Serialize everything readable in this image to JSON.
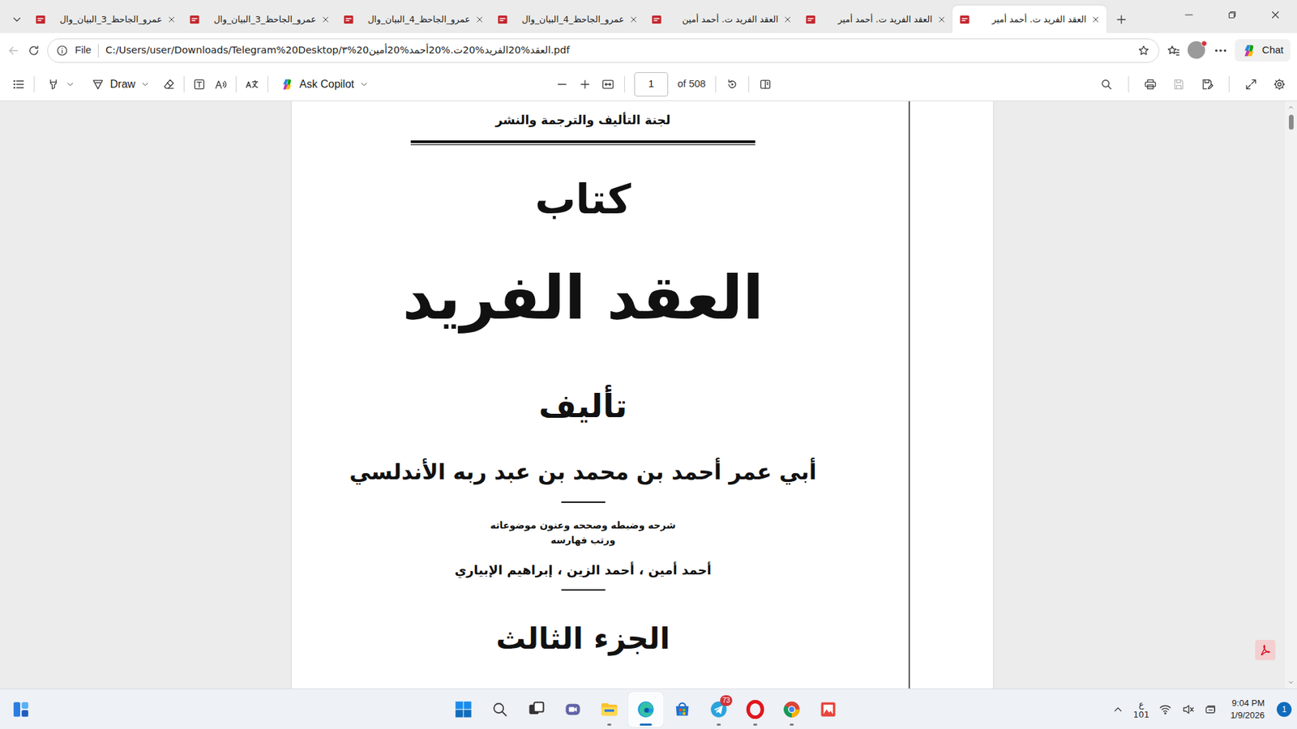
{
  "tabs": [
    {
      "label": "عمرو_الجاحظ_3_البيان_وال",
      "selected": false
    },
    {
      "label": "عمرو_الجاحظ_3_البيان_وال",
      "selected": false
    },
    {
      "label": "عمرو_الجاحظ_4_البيان_وال",
      "selected": false
    },
    {
      "label": "عمرو_الجاحظ_4_البيان_وال",
      "selected": false
    },
    {
      "label": "العقد الفريد ت. أحمد أمين",
      "selected": false
    },
    {
      "label": "العقد الفريد ت. أحمد أمير",
      "selected": false
    },
    {
      "label": "العقد الفريد ت. أحمد أمير",
      "selected": true
    }
  ],
  "address_bar": {
    "scheme": "File",
    "url": "C:/Users/user/Downloads/Telegram%20Desktop/٣%20العقد%20الفريد%20ت.%20أحمد%20أمين.pdf"
  },
  "profile": {
    "alert": true
  },
  "chat_button": {
    "label": "Chat"
  },
  "pdf_toolbar": {
    "draw_label": "Draw",
    "copilot_label": "Ask Copilot",
    "page": "1",
    "page_count": "of 508",
    "save_disabled": true
  },
  "document": {
    "publisher": "لجنة التأليف والترجمة والنشر",
    "book_word": "كتاب",
    "title": "العقد الفريد",
    "author_intro": "تأليف",
    "author": "أبي عمر أحمد بن محمد بن عبد ربه الأندلسي",
    "credits_line1": "شرحه وضبطه وصححه وعنون موضوعاته",
    "credits_line2": "ورتب فهارسه",
    "editors": "أحمد أمين ، أحمد الزين ، إبراهيم الإبياري",
    "volume": "الجزء الثالث"
  },
  "taskbar": {
    "apps": [
      {
        "kind": "start",
        "running": false,
        "active": false
      },
      {
        "kind": "search",
        "running": false,
        "active": false
      },
      {
        "kind": "taskview",
        "running": false,
        "active": false
      },
      {
        "kind": "teams",
        "running": false,
        "active": false
      },
      {
        "kind": "files",
        "running": true,
        "active": false
      },
      {
        "kind": "edge",
        "running": true,
        "active": true
      },
      {
        "kind": "store",
        "running": false,
        "active": false
      },
      {
        "kind": "telegram",
        "running": true,
        "active": false,
        "badge": "73"
      },
      {
        "kind": "opera",
        "running": true,
        "active": false
      },
      {
        "kind": "chrome",
        "running": true,
        "active": false
      },
      {
        "kind": "imageapp",
        "running": false,
        "active": false
      }
    ],
    "tray": {
      "input_lang": "ع",
      "input_code": "101",
      "volume_muted": true,
      "time": "9:04 PM",
      "date": "1/9/2026",
      "notifications": "1"
    }
  }
}
